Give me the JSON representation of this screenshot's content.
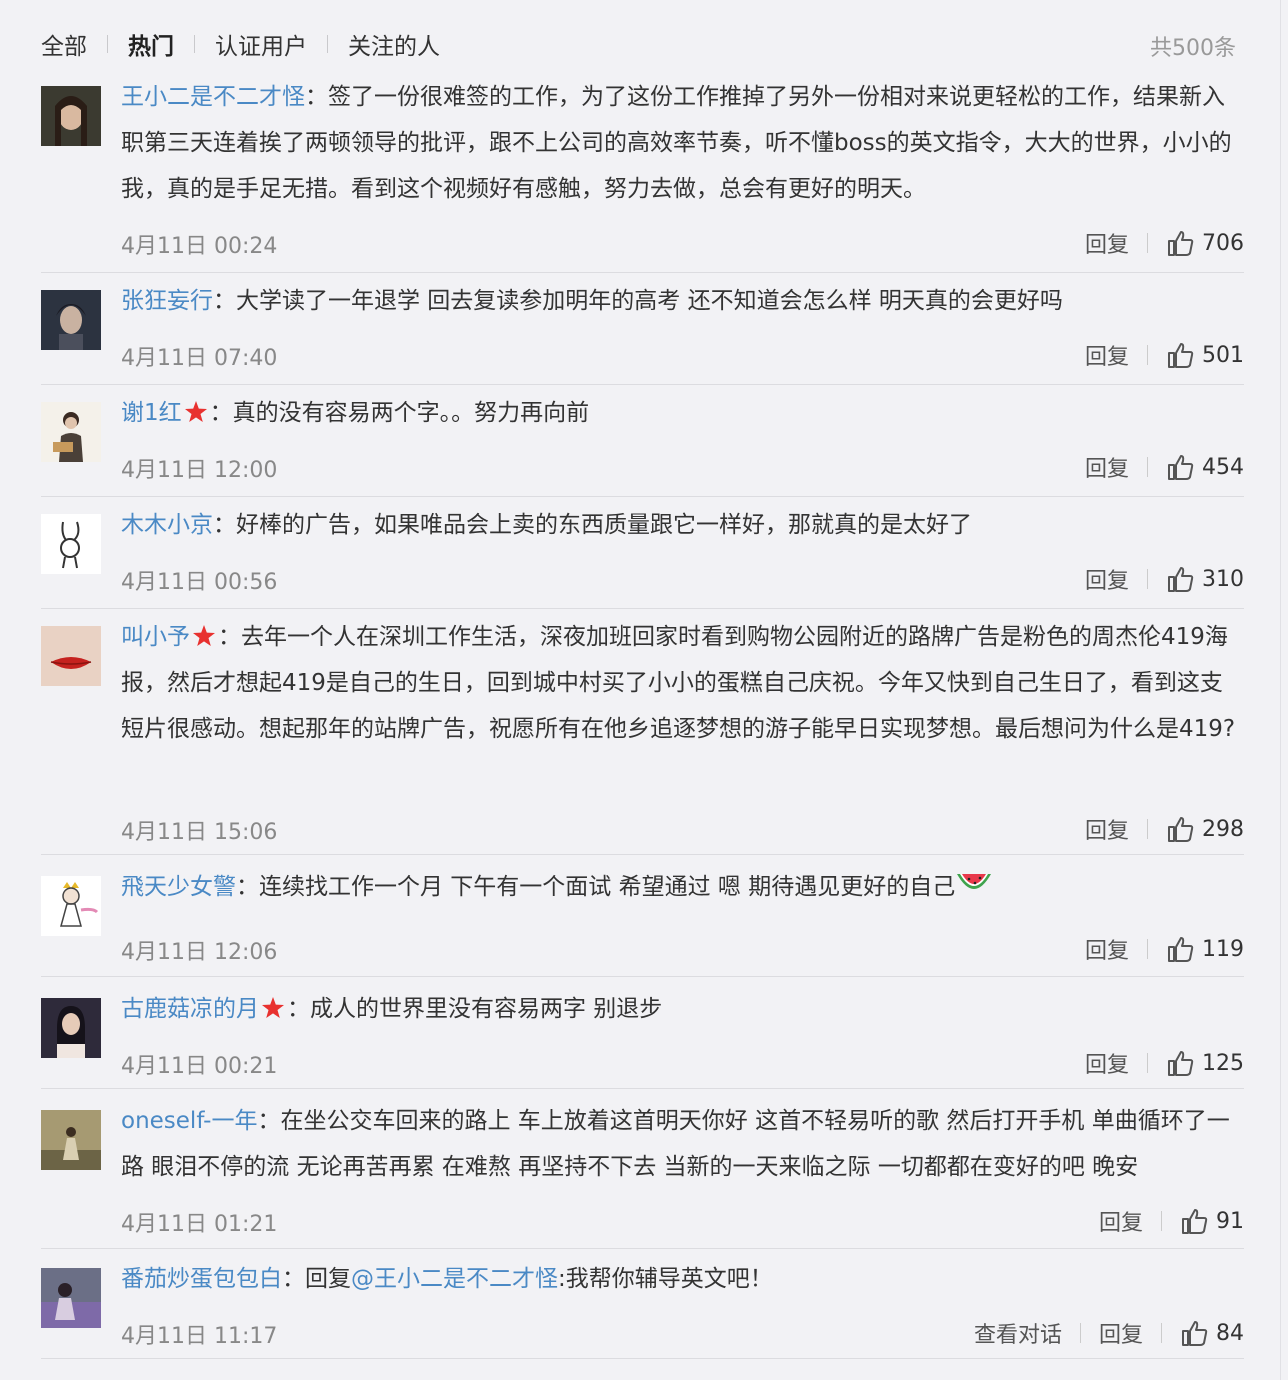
{
  "filter": {
    "tabs": [
      "全部",
      "热门",
      "认证用户",
      "关注的人"
    ],
    "total": "共500条"
  },
  "actions": {
    "reply": "回复",
    "view_conversation": "查看对话"
  },
  "colors": {
    "link": "#4a89c5",
    "star": "#e8312f",
    "background": "#f2f2f5"
  },
  "comments": [
    {
      "user": "王小二是不二才怪",
      "sep": "：",
      "text": "签了一份很难签的工作，为了这份工作推掉了另外一份相对来说更轻松的工作，结果新入职第三天连着挨了两顿领导的批评，跟不上公司的高效率节奏，听不懂boss的英文指令，大大的世界，小小的我，真的是手足无措。看到这个视频好有感触，努力去做，总会有更好的明天。",
      "time": "4月11日 00:24",
      "likes": "706"
    },
    {
      "user": "张狂妄行",
      "sep": "：",
      "text": "大学读了一年退学 回去复读参加明年的高考 还不知道会怎么样 明天真的会更好吗",
      "time": "4月11日 07:40",
      "likes": "501"
    },
    {
      "user": "谢1红",
      "sep": "：",
      "text": "真的没有容易两个字。。努力再向前",
      "time": "4月11日 12:00",
      "likes": "454"
    },
    {
      "user": "木木小京",
      "sep": "：",
      "text": "好棒的广告，如果唯品会上卖的东西质量跟它一样好，那就真的是太好了",
      "time": "4月11日 00:56",
      "likes": "310"
    },
    {
      "user": "叫小予",
      "sep": "：",
      "text": "去年一个人在深圳工作生活，深夜加班回家时看到购物公园附近的路牌广告是粉色的周杰伦419海报，然后才想起419是自己的生日，回到城中村买了小小的蛋糕自己庆祝。今年又快到自己生日了，看到这支短片很感动。想起那年的站牌广告，祝愿所有在他乡追逐梦想的游子能早日实现梦想。最后想问为什么是419?",
      "time": "4月11日 15:06",
      "likes": "298"
    },
    {
      "user": "飛天少女警",
      "sep": "：",
      "text": "连续找工作一个月 下午有一个面试 希望通过 嗯 期待遇见更好的自己",
      "time": "4月11日 12:06",
      "likes": "119"
    },
    {
      "user": "古鹿菇凉的月",
      "sep": "：",
      "text": "成人的世界里没有容易两字 别退步",
      "time": "4月11日 00:21",
      "likes": "125"
    },
    {
      "user": "oneself-一年",
      "sep": "：",
      "text": "在坐公交车回来的路上 车上放着这首明天你好 这首不轻易听的歌 然后打开手机 单曲循环了一路 眼泪不停的流 无论再苦再累 在难熬 再坚持不下去 当新的一天来临之际 一切都都在变好的吧 晚安",
      "time": "4月11日 01:21",
      "likes": "91"
    },
    {
      "user": "番茄炒蛋包包白",
      "sep": "：",
      "text_prefix": "回复",
      "mention": "@王小二是不二才怪",
      "text": ":我帮你辅导英文吧！",
      "time": "4月11日 11:17",
      "likes": "84"
    }
  ]
}
